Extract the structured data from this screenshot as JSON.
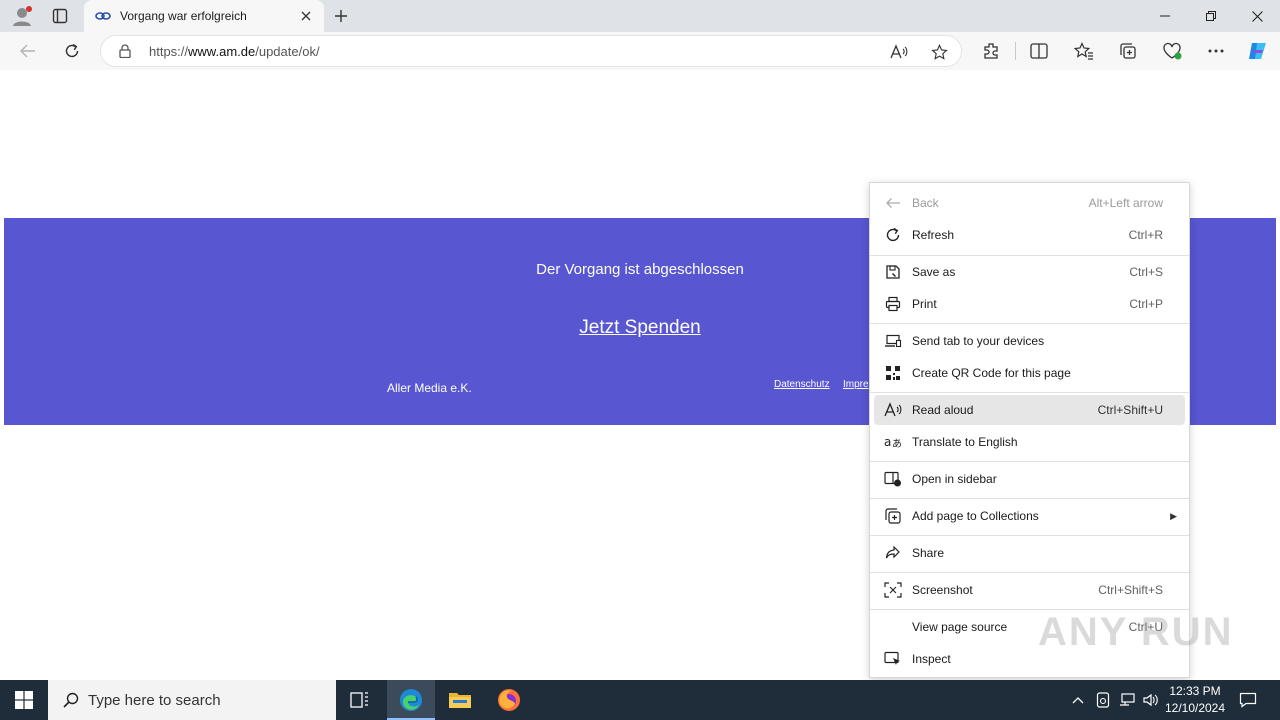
{
  "browser": {
    "tab": {
      "title": "Vorgang war erfolgreich"
    },
    "address": {
      "scheme": "https://",
      "host": "www.am.de",
      "path": "/update/ok/"
    }
  },
  "page": {
    "message": "Der Vorgang ist abgeschlossen",
    "donate_link": "Jetzt Spenden",
    "owner": "Aller Media e.K.",
    "footer_links": [
      "Datenschutz",
      "Impre"
    ]
  },
  "context_menu": {
    "items": [
      {
        "label": "Back",
        "shortcut": "Alt+Left arrow",
        "icon": "back-arrow-icon",
        "disabled": true
      },
      {
        "label": "Refresh",
        "shortcut": "Ctrl+R",
        "icon": "refresh-icon"
      },
      {
        "label": "Save as",
        "shortcut": "Ctrl+S",
        "icon": "save-icon"
      },
      {
        "label": "Print",
        "shortcut": "Ctrl+P",
        "icon": "printer-icon"
      },
      {
        "label": "Send tab to your devices",
        "shortcut": "",
        "icon": "devices-icon"
      },
      {
        "label": "Create QR Code for this page",
        "shortcut": "",
        "icon": "qr-code-icon"
      },
      {
        "label": "Read aloud",
        "shortcut": "Ctrl+Shift+U",
        "icon": "read-aloud-icon",
        "highlighted": true
      },
      {
        "label": "Translate to English",
        "shortcut": "",
        "icon": "translate-icon"
      },
      {
        "label": "Open in sidebar",
        "shortcut": "",
        "icon": "sidebar-icon"
      },
      {
        "label": "Add page to Collections",
        "shortcut": "",
        "icon": "collections-icon",
        "submenu": true
      },
      {
        "label": "Share",
        "shortcut": "",
        "icon": "share-icon"
      },
      {
        "label": "Screenshot",
        "shortcut": "Ctrl+Shift+S",
        "icon": "screenshot-icon"
      },
      {
        "label": "View page source",
        "shortcut": "Ctrl+U",
        "icon": ""
      },
      {
        "label": "Inspect",
        "shortcut": "",
        "icon": "inspect-icon"
      }
    ]
  },
  "watermark": "ANY RUN",
  "taskbar": {
    "search_placeholder": "Type here to search",
    "time": "12:33 PM",
    "date": "12/10/2024"
  },
  "colors": {
    "banner": "#5856d0",
    "taskbar": "#1f2c3a",
    "edge_accent": "#1c8ad6"
  }
}
